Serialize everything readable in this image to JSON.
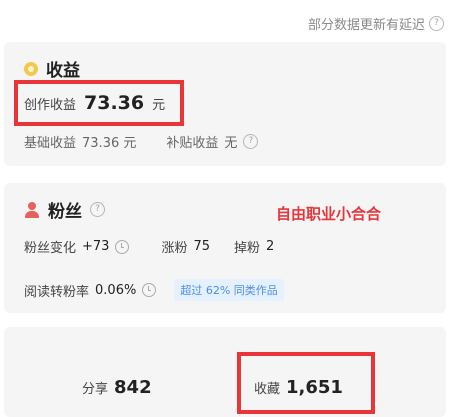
{
  "header": {
    "notice": "部分数据更新有延迟"
  },
  "income": {
    "title": "收益",
    "creation_label": "创作收益",
    "creation_value": "73.36",
    "creation_unit": "元",
    "base_label": "基础收益",
    "base_value": "73.36 元",
    "subsidy_label": "补贴收益",
    "subsidy_value": "无"
  },
  "fans": {
    "title": "粉丝",
    "promo": "自由职业小合合",
    "change_label": "粉丝变化",
    "change_value": "+73",
    "gain_label": "涨粉",
    "gain_value": "75",
    "loss_label": "掉粉",
    "loss_value": "2",
    "conversion_label": "阅读转粉率",
    "conversion_value": "0.06%",
    "badge": "超过 62% 同类作品"
  },
  "stats": {
    "share_label": "分享",
    "share_value": "842",
    "fav_label": "收藏",
    "fav_value": "1,651"
  },
  "colors": {
    "highlight": "#e8353a",
    "badge_bg": "#e6f1ff",
    "badge_text": "#4a8ee6"
  }
}
